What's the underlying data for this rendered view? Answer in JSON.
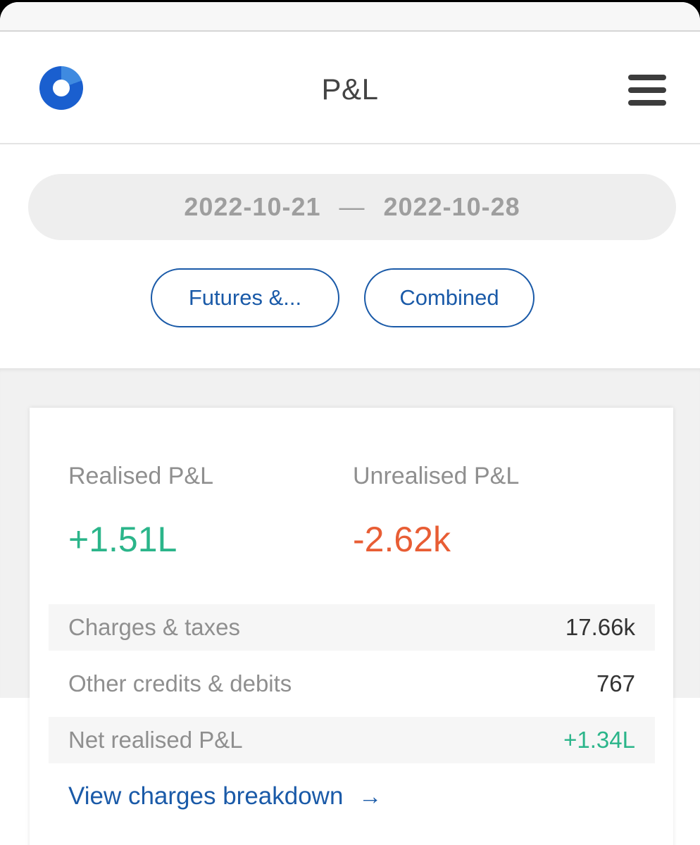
{
  "header": {
    "title": "P&L",
    "logo_icon": "ring-logo-icon",
    "menu_icon": "hamburger-menu-icon"
  },
  "filters": {
    "date_from": "2022-10-21",
    "date_separator": "—",
    "date_to": "2022-10-28",
    "segment_label": "Futures &...",
    "mode_label": "Combined"
  },
  "summary": {
    "realised_label": "Realised P&L",
    "realised_value": "+1.51L",
    "unrealised_label": "Unrealised P&L",
    "unrealised_value": "-2.62k",
    "rows": [
      {
        "label": "Charges & taxes",
        "value": "17.66k"
      },
      {
        "label": "Other credits & debits",
        "value": "767"
      },
      {
        "label": "Net realised P&L",
        "value": "+1.34L"
      }
    ],
    "breakdown_link": "View charges breakdown",
    "arrow_icon": "→"
  },
  "colors": {
    "accent": "#1a5aa8",
    "positive": "#2bb58a",
    "negative": "#e85d34",
    "logo": "#1a5fcf"
  }
}
